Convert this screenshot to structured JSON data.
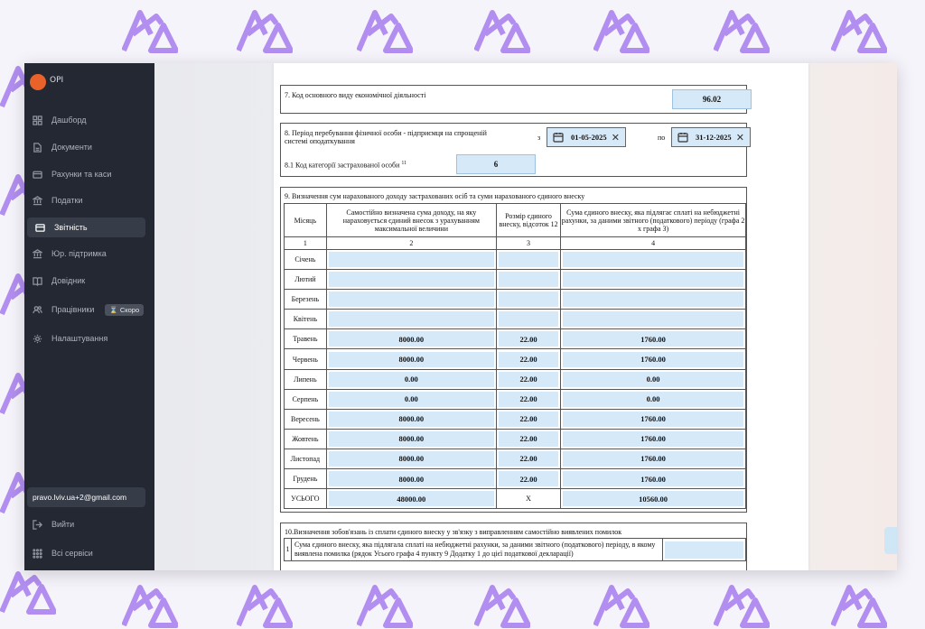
{
  "app": {
    "logo_text": "ОРІ"
  },
  "sidebar": {
    "items": [
      {
        "label": "Дашборд",
        "icon": "grid-icon"
      },
      {
        "label": "Документи",
        "icon": "document-icon"
      },
      {
        "label": "Рахунки та каси",
        "icon": "wallet-icon"
      },
      {
        "label": "Податки",
        "icon": "bank-icon"
      },
      {
        "label": "Звітність",
        "icon": "report-icon"
      },
      {
        "label": "Юр. підтримка",
        "icon": "institution-icon"
      },
      {
        "label": "Довідник",
        "icon": "book-icon"
      },
      {
        "label": "Працівники",
        "icon": "users-icon"
      },
      {
        "label": "Налаштування",
        "icon": "gear-icon"
      }
    ],
    "active": "Звітність",
    "workers_badge": "Скоро",
    "email": "pravo.lviv.ua+2@gmail.com",
    "logout_label": "Вийти",
    "all_services_label": "Всі сервіси"
  },
  "form": {
    "s7": {
      "label": "7. Код основного виду економічної діяльності",
      "value": "96.02"
    },
    "s8": {
      "label": "8. Період перебування фізичної особи - підприємця на спрощеній системі оподаткування",
      "from_label": "з",
      "from_value": "01-05-2025",
      "to_label": "по",
      "to_value": "31-12-2025",
      "sub_label": "8.1 Код категорії застрахованої особи",
      "sub_footnote": "11",
      "sub_value": "6"
    },
    "s9": {
      "title": "9. Визначення сум нарахованого доходу застрахованих осіб та суми нарахованого єдиного внеску",
      "headers": [
        "Місяць",
        "Самостійно визначена сума доходу, на яку нараховується єдиний внесок з урахуванням максимальної величини",
        "Розмір єдиного внеску, відсоток 12",
        "Сума єдиного внеску, яка підлягає сплаті на небюджетні рахунки, за даними звітного (податкового) періоду (графа 2 х графа 3)"
      ],
      "col_numbers": [
        "1",
        "2",
        "3",
        "4"
      ],
      "rows": [
        {
          "month": "Січень",
          "income": "",
          "rate": "",
          "sum": ""
        },
        {
          "month": "Лютий",
          "income": "",
          "rate": "",
          "sum": ""
        },
        {
          "month": "Березень",
          "income": "",
          "rate": "",
          "sum": ""
        },
        {
          "month": "Квітень",
          "income": "",
          "rate": "",
          "sum": ""
        },
        {
          "month": "Травень",
          "income": "8000.00",
          "rate": "22.00",
          "sum": "1760.00"
        },
        {
          "month": "Червень",
          "income": "8000.00",
          "rate": "22.00",
          "sum": "1760.00"
        },
        {
          "month": "Липень",
          "income": "0.00",
          "rate": "22.00",
          "sum": "0.00"
        },
        {
          "month": "Серпень",
          "income": "0.00",
          "rate": "22.00",
          "sum": "0.00"
        },
        {
          "month": "Вересень",
          "income": "8000.00",
          "rate": "22.00",
          "sum": "1760.00"
        },
        {
          "month": "Жовтень",
          "income": "8000.00",
          "rate": "22.00",
          "sum": "1760.00"
        },
        {
          "month": "Листопад",
          "income": "8000.00",
          "rate": "22.00",
          "sum": "1760.00"
        },
        {
          "month": "Грудень",
          "income": "8000.00",
          "rate": "22.00",
          "sum": "1760.00"
        }
      ],
      "total": {
        "month": "УСЬОГО",
        "income": "48000.00",
        "rate": "X",
        "sum": "10560.00"
      }
    },
    "s10": {
      "title": "10.Визначення зобов'язань із сплати єдиного внеску у зв'язку з виправленням самостійно виявлених помилок",
      "row_number": "1",
      "row_text": "Сума єдиного внеску, яка підлягала сплаті на небюджетні рахунки, за даними звітного (податкового) періоду, в якому виявлена помилка (рядок Усього графа 4 пункту 9 Додатку 1 до цієї податкової декларації)",
      "row_value": ""
    }
  },
  "colors": {
    "sidebar_bg": "#232833",
    "field_bg": "#d6e9f8",
    "accent": "#e8622a",
    "watermark": "#b28ef0"
  }
}
